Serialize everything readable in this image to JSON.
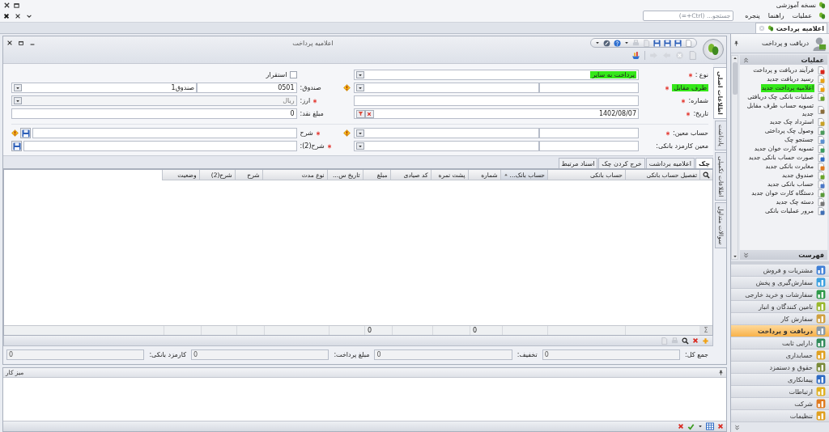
{
  "app": {
    "title": "نسخه آموزشی"
  },
  "menu": [
    {
      "label": "عملیات"
    },
    {
      "label": "راهنما"
    },
    {
      "label": "پنجره"
    }
  ],
  "search": {
    "placeholder": "جستجو... (Ctrl+=)"
  },
  "doc_tabs": [
    {
      "label": "اعلامیه پرداخت",
      "selected": true
    }
  ],
  "form_window": {
    "title": "اعلامیه پرداخت",
    "side_tabs": [
      {
        "label": "اطلاعات اصلی",
        "selected": true
      },
      {
        "label": "یادداشت",
        "selected": false
      },
      {
        "label": "اطلاعات تکمیلی",
        "selected": false
      },
      {
        "label": "سوالات متداول",
        "selected": false
      }
    ],
    "right_fields": [
      {
        "label": "نوع :",
        "required": true,
        "label_highlighted": false,
        "kind": "combo",
        "value": "پرداخت به سایر",
        "value_highlighted": true
      },
      {
        "label": "طرف مقابل",
        "required": true,
        "label_highlighted": true,
        "kind": "lookup"
      },
      {
        "label": "شماره:",
        "required": true,
        "label_highlighted": false,
        "kind": "text"
      },
      {
        "label": "تاریخ:",
        "required": true,
        "label_highlighted": false,
        "kind": "date",
        "value": "1402/08/07"
      },
      {
        "label": "حساب معین:",
        "required": true,
        "label_highlighted": false,
        "kind": "lookup"
      },
      {
        "label": "معین کارمزد بانکی:",
        "required": false,
        "label_highlighted": false,
        "kind": "lookup"
      }
    ],
    "left_fields": [
      {
        "kind": "checkbox",
        "label": "استقرار",
        "checked": false
      },
      {
        "kind": "lookup",
        "label": "صندوق:",
        "required": false,
        "warning": true,
        "code": "0501",
        "value": "صندوق1",
        "disabled": false
      },
      {
        "kind": "combo",
        "label": "ارز:",
        "required": true,
        "warning": false,
        "value": "ریال",
        "disabled": true
      },
      {
        "kind": "text",
        "label": "مبلغ نقد:",
        "required": false,
        "warning": false,
        "value": "0"
      },
      {
        "kind": "memo",
        "label": "شرح",
        "required": true,
        "warning": true
      },
      {
        "kind": "memo",
        "label": "شرح(2):",
        "required": true,
        "warning": false
      }
    ],
    "sub_tabs": [
      {
        "label": "چک",
        "selected": true
      },
      {
        "label": "اعلامیه برداشت",
        "selected": false
      },
      {
        "label": "خرج کردن چک",
        "selected": false
      },
      {
        "label": "اسناد مرتبط",
        "selected": false
      }
    ],
    "table": {
      "footer_symbol": "Σ",
      "columns": [
        {
          "label": "تفصیل حساب بانکی",
          "sorted": false
        },
        {
          "label": "حساب بانکی",
          "sorted": false
        },
        {
          "label": "حساب بانک...",
          "sorted": true
        },
        {
          "label": "شماره",
          "sorted": false,
          "total": "0"
        },
        {
          "label": "پشت نمره",
          "sorted": false
        },
        {
          "label": "کد صیادی",
          "sorted": false
        },
        {
          "label": "مبلغ",
          "sorted": false,
          "total": "0"
        },
        {
          "label": "تاریخ س...",
          "sorted": false
        },
        {
          "label": "نوع مدت",
          "sorted": false
        },
        {
          "label": "شرح",
          "sorted": false
        },
        {
          "label": "شرح(2)",
          "sorted": false
        },
        {
          "label": "وضعیت",
          "sorted": false
        }
      ]
    },
    "totals": [
      {
        "label": "جمع کل:",
        "value": "0"
      },
      {
        "label": "تخفیف:",
        "value": "0"
      },
      {
        "label": "مبلغ پرداخت:",
        "value": "0"
      },
      {
        "label": "کارمزد بانکی:",
        "value": "0"
      }
    ]
  },
  "workspace": {
    "title": "میز کار"
  },
  "sidebar": {
    "title": "دریافت و پرداخت",
    "sections": [
      {
        "title": "عملیات",
        "expanded": true,
        "items": [
          {
            "label": "فرآیند دریافت و پرداخت",
            "highlighted": false
          },
          {
            "label": "رسید دریافت جدید",
            "highlighted": false
          },
          {
            "label": "اعلامیه پرداخت جدید",
            "highlighted": true
          },
          {
            "label": "عملیات بانکی چک دریافتی",
            "highlighted": false
          },
          {
            "label": "تسویه حساب طرف مقابل جدید",
            "highlighted": false
          },
          {
            "label": "استرداد چک جدید",
            "highlighted": false
          },
          {
            "label": "وصول چک پرداختی",
            "highlighted": false
          },
          {
            "label": "جستجو چک",
            "highlighted": false
          },
          {
            "label": "تسویه کارت خوان جدید",
            "highlighted": false
          },
          {
            "label": "صورت حساب بانکی جدید",
            "highlighted": false
          },
          {
            "label": "مغایرت بانکی جدید",
            "highlighted": false
          },
          {
            "label": "صندوق جدید",
            "highlighted": false
          },
          {
            "label": "حساب بانکی جدید",
            "highlighted": false
          },
          {
            "label": "دستگاه کارت خوان جدید",
            "highlighted": false
          },
          {
            "label": "دسته چک جدید",
            "highlighted": false
          },
          {
            "label": "مرور عملیات بانکی",
            "highlighted": false
          }
        ]
      },
      {
        "title": "فهرست",
        "expanded": false
      }
    ],
    "modules": [
      {
        "label": "مشتریات و فروش",
        "selected": false
      },
      {
        "label": "سفارش‌گیری و پخش",
        "selected": false
      },
      {
        "label": "سفارشات و خرید خارجی",
        "selected": false
      },
      {
        "label": "تامین کنندگان و انبار",
        "selected": false
      },
      {
        "label": "سفارش کار",
        "selected": false
      },
      {
        "label": "دریافت و پرداخت",
        "selected": true
      },
      {
        "label": "دارایی ثابت",
        "selected": false
      },
      {
        "label": "حسابداری",
        "selected": false
      },
      {
        "label": "حقوق و دستمزد",
        "selected": false
      },
      {
        "label": "پیمانکاری",
        "selected": false
      },
      {
        "label": "ارتباطات",
        "selected": false
      },
      {
        "label": "شرکت",
        "selected": false
      },
      {
        "label": "تنظیمات",
        "selected": false
      }
    ]
  }
}
